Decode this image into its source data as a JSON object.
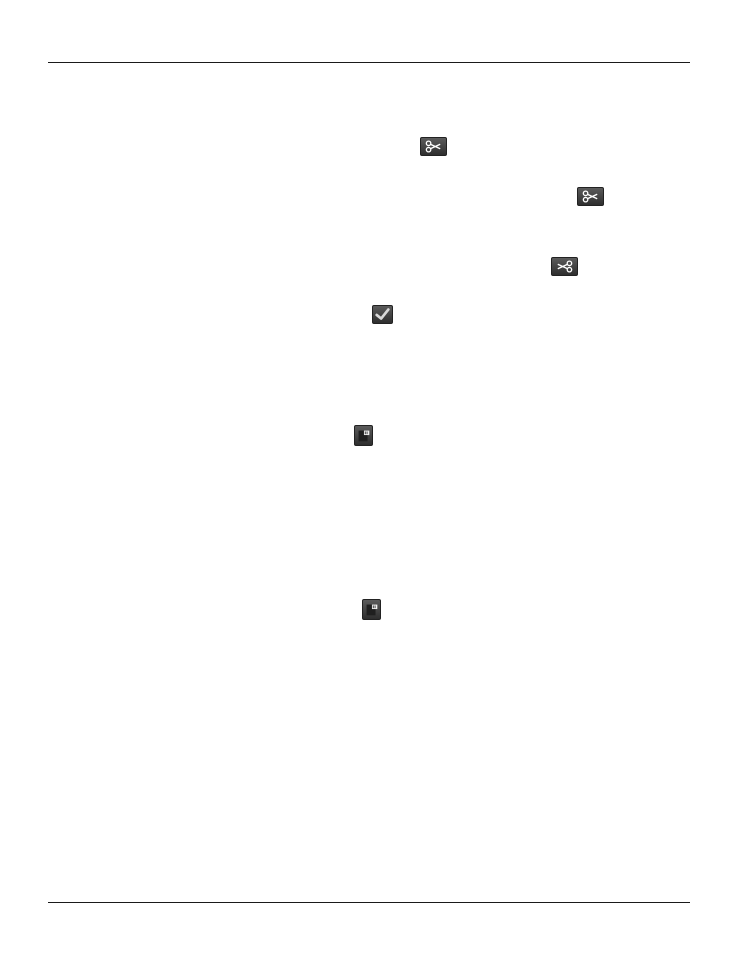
{
  "page": {
    "header_rule": true,
    "footer_rule": true
  },
  "icons": [
    {
      "name": "scissors-icon",
      "glyph": "cut"
    },
    {
      "name": "scissors-icon",
      "glyph": "cut"
    },
    {
      "name": "scissors-icon",
      "glyph": "cut"
    },
    {
      "name": "check-icon",
      "glyph": "confirm"
    },
    {
      "name": "card-icon",
      "glyph": "card"
    },
    {
      "name": "card-icon",
      "glyph": "card"
    }
  ],
  "colors": {
    "rule": "#1a1a1a",
    "icon_background": "#3f3f3f",
    "icon_foreground": "#ffffff"
  }
}
